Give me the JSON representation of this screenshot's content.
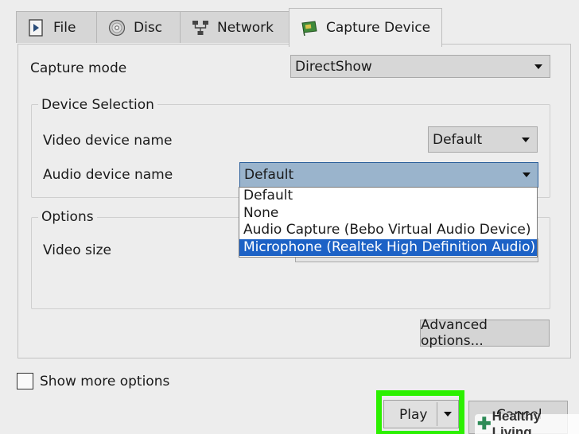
{
  "tabs": [
    {
      "label": "File",
      "icon": "file-play-icon"
    },
    {
      "label": "Disc",
      "icon": "disc-icon"
    },
    {
      "label": "Network",
      "icon": "network-icon"
    },
    {
      "label": "Capture Device",
      "icon": "capture-card-icon",
      "active": true
    }
  ],
  "capture_mode": {
    "label": "Capture mode",
    "value": "DirectShow"
  },
  "device_selection": {
    "title": "Device Selection",
    "video_label": "Video device name",
    "video_value": "Default",
    "audio_label": "Audio device name",
    "audio_value": "Default",
    "audio_options": [
      "Default",
      "None",
      "Audio Capture (Bebo Virtual Audio Device)",
      "Microphone (Realtek High Definition Audio)"
    ],
    "audio_selected_index": 3
  },
  "options": {
    "title": "Options",
    "video_size_label": "Video size"
  },
  "advanced_button": "Advanced options...",
  "show_more": "Show more options",
  "play_button": "Play",
  "cancel_button": "Cancel",
  "watermark": "Healthy Living",
  "colors": {
    "selection": "#1d62c6",
    "highlight": "#2cf000",
    "active_combo": "#9ab4cc"
  }
}
